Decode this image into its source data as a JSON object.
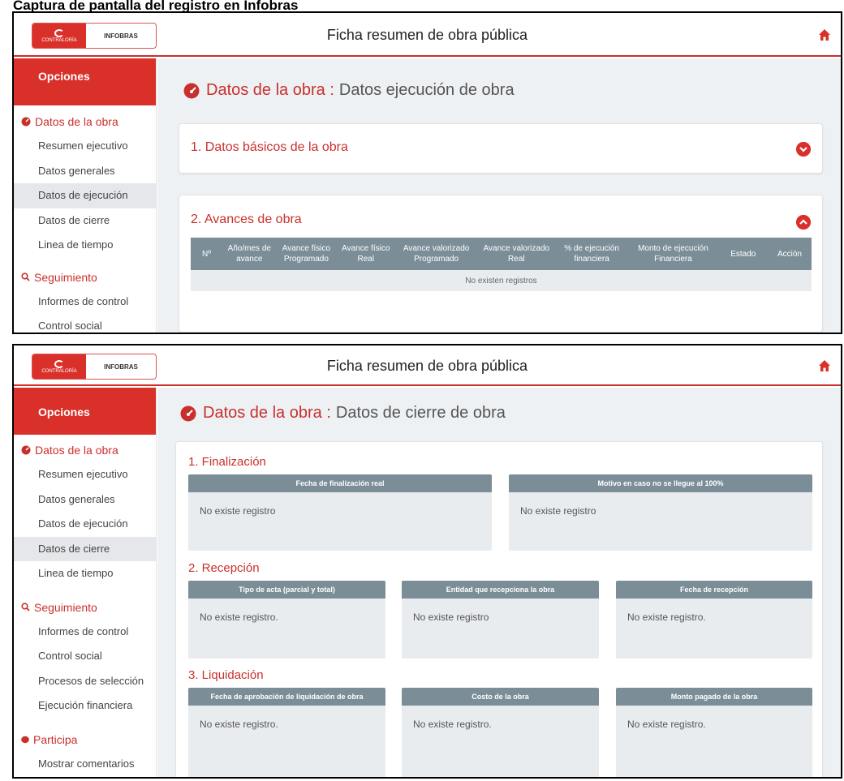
{
  "caption": "Captura de pantalla del registro en Infobras",
  "logo": {
    "org": "CONTRALORÍA",
    "system": "INFOBRAS"
  },
  "header": {
    "title": "Ficha resumen de obra pública"
  },
  "sidebar": {
    "opciones": "Opciones",
    "section_datos": "Datos de la obra",
    "items_datos": [
      "Resumen ejecutivo",
      "Datos generales",
      "Datos de ejecución",
      "Datos de cierre",
      "Linea de tiempo"
    ],
    "section_seguimiento": "Seguimiento",
    "items_seguimiento_1": [
      "Informes de control",
      "Control social"
    ],
    "items_seguimiento_2": [
      "Informes de control",
      "Control social",
      "Procesos de selección",
      "Ejecución financiera"
    ],
    "section_participa": "Participa",
    "items_participa": [
      "Mostrar comentarios"
    ]
  },
  "screen1": {
    "title_main": "Datos de la obra :",
    "title_sub": "Datos ejecución de obra",
    "card1_title": "1. Datos básicos de la obra",
    "card2_title": "2. Avances de obra",
    "table_headers": [
      [
        "Nº"
      ],
      [
        "Año/mes de",
        "avance"
      ],
      [
        "Avance físico",
        "Programado"
      ],
      [
        "Avance físico",
        "Real"
      ],
      [
        "Avance valorizado",
        "Programado"
      ],
      [
        "Avance valorizado",
        "Real"
      ],
      [
        "% de ejecución",
        "financiera"
      ],
      [
        "Monto de ejecución",
        "Financiera"
      ],
      [
        "Estado"
      ],
      [
        "Acción"
      ]
    ],
    "empty_row": "No existen registros"
  },
  "screen2": {
    "title_main": "Datos de la obra :",
    "title_sub": "Datos de cierre de obra",
    "finalizacion": {
      "title": "1. Finalización",
      "boxes": [
        {
          "header": "Fecha de finalización real",
          "value": "No existe registro"
        },
        {
          "header": "Motivo en caso no se llegue al 100%",
          "value": "No existe registro"
        }
      ]
    },
    "recepcion": {
      "title": "2. Recepción",
      "boxes": [
        {
          "header": "Tipo de acta (parcial y total)",
          "value": "No existe registro."
        },
        {
          "header": "Entidad que recepciona la obra",
          "value": "No existe registro"
        },
        {
          "header": "Fecha de recepción",
          "value": "No existe registro."
        }
      ]
    },
    "liquidacion": {
      "title": "3. Liquidación",
      "boxes": [
        {
          "header": "Fecha de aprobación de liquidación de obra",
          "value": "No existe registro."
        },
        {
          "header": "Costo de la obra",
          "value": "No existe registro."
        },
        {
          "header": "Monto pagado de la obra",
          "value": "No existe registro."
        }
      ]
    }
  },
  "colors": {
    "accent": "#d9302a",
    "table_header": "#7b8e98",
    "content_bg": "#eef1f4",
    "cell_bg": "#e9ecef"
  }
}
